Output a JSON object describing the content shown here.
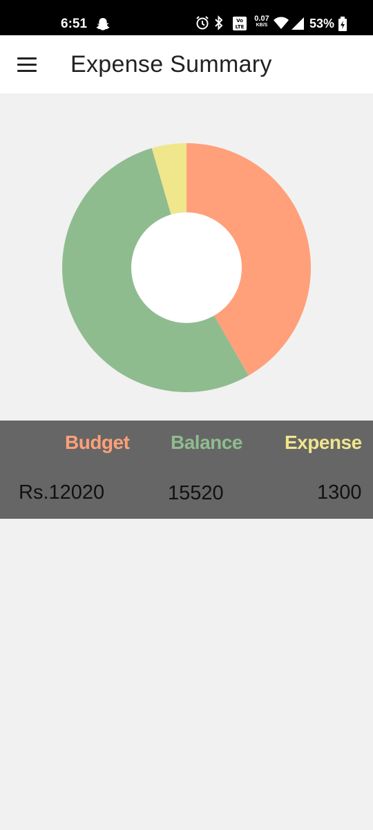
{
  "status_bar": {
    "time": "6:51",
    "net_speed": "0.07",
    "net_unit": "KB/S",
    "battery": "53%",
    "icons": [
      "snapchat-icon",
      "alarm-icon",
      "bluetooth-icon",
      "volte-icon",
      "wifi-icon",
      "signal-icon",
      "battery-charging-icon"
    ]
  },
  "app_bar": {
    "title": "Expense Summary",
    "menu_icon": "hamburger-menu-icon"
  },
  "colors": {
    "budget": "#ffa07a",
    "balance": "#8fbc8f",
    "expense": "#f0e68c",
    "panel": "#666666"
  },
  "chart_data": {
    "type": "pie",
    "categories": [
      "Budget",
      "Balance",
      "Expense"
    ],
    "values": [
      12020,
      15520,
      1300
    ],
    "colors": [
      "#ffa07a",
      "#8fbc8f",
      "#f0e68c"
    ],
    "donut": true
  },
  "summary": {
    "headers": {
      "budget": "Budget",
      "balance": "Balance",
      "expense": "Expense"
    },
    "values": {
      "budget": "Rs.12020",
      "balance": "15520",
      "expense": "1300"
    }
  }
}
